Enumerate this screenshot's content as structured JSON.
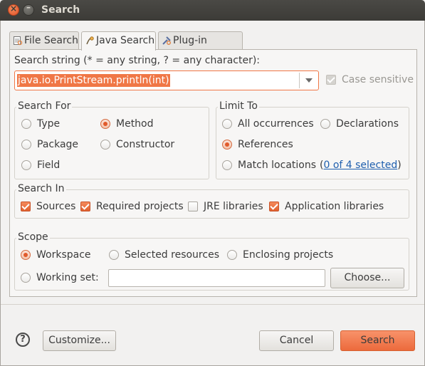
{
  "window": {
    "title": "Search"
  },
  "tabs": [
    {
      "label": "File Search",
      "icon": "file-search-icon",
      "active": false
    },
    {
      "label": "Java Search",
      "icon": "java-search-icon",
      "active": true
    },
    {
      "label": "Plug-in Search",
      "icon": "plugin-search-icon",
      "active": false
    }
  ],
  "search": {
    "label": "Search string (* = any string, ? = any character):",
    "value": "java.io.PrintStream.println(int)",
    "case_sensitive_label": "Case sensitive",
    "case_sensitive_checked": true,
    "case_sensitive_enabled": false
  },
  "search_for": {
    "title": "Search For",
    "options": {
      "type": "Type",
      "method": "Method",
      "package": "Package",
      "constructor": "Constructor",
      "field": "Field"
    },
    "selected": "Method"
  },
  "limit_to": {
    "title": "Limit To",
    "all_occurrences": "All occurrences",
    "declarations": "Declarations",
    "references": "References",
    "match_locations": "Match locations",
    "paren_open": "(",
    "match_link": "0 of 4 selected",
    "paren_close": ")",
    "selected": "References"
  },
  "search_in": {
    "title": "Search In",
    "sources": "Sources",
    "required_projects": "Required projects",
    "jre_libraries": "JRE libraries",
    "application_libraries": "Application libraries",
    "checked": [
      "Sources",
      "Required projects",
      "Application libraries"
    ]
  },
  "scope": {
    "title": "Scope",
    "workspace": "Workspace",
    "selected_resources": "Selected resources",
    "enclosing_projects": "Enclosing projects",
    "working_set": "Working set:",
    "working_set_value": "",
    "choose_button": "Choose...",
    "selected": "Workspace"
  },
  "footer": {
    "help_glyph": "?",
    "customize_button": "Customize...",
    "cancel_button": "Cancel",
    "search_button": "Search"
  },
  "colors": {
    "accent": "#f07746",
    "link": "#1f5fae",
    "titlebar": "#3c3b37"
  }
}
